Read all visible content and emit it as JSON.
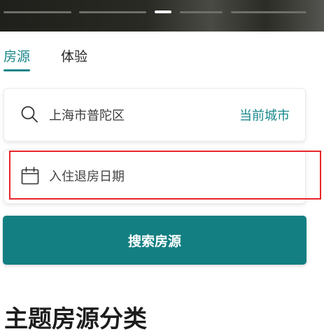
{
  "carousel": {
    "slide_count": 5,
    "active_index": 2
  },
  "tabs": [
    {
      "label": "房源",
      "active": true
    },
    {
      "label": "体验",
      "active": false
    }
  ],
  "search_form": {
    "city_value": "上海市普陀区",
    "current_city_link": "当前城市",
    "date_placeholder": "入住退房日期",
    "search_button": "搜索房源"
  },
  "section": {
    "title": "主题房源分类"
  },
  "colors": {
    "accent": "#17868a",
    "button": "#137f82",
    "highlight": "#e8252b"
  },
  "icons": {
    "city_field": "search-icon",
    "date_field": "calendar-icon"
  }
}
